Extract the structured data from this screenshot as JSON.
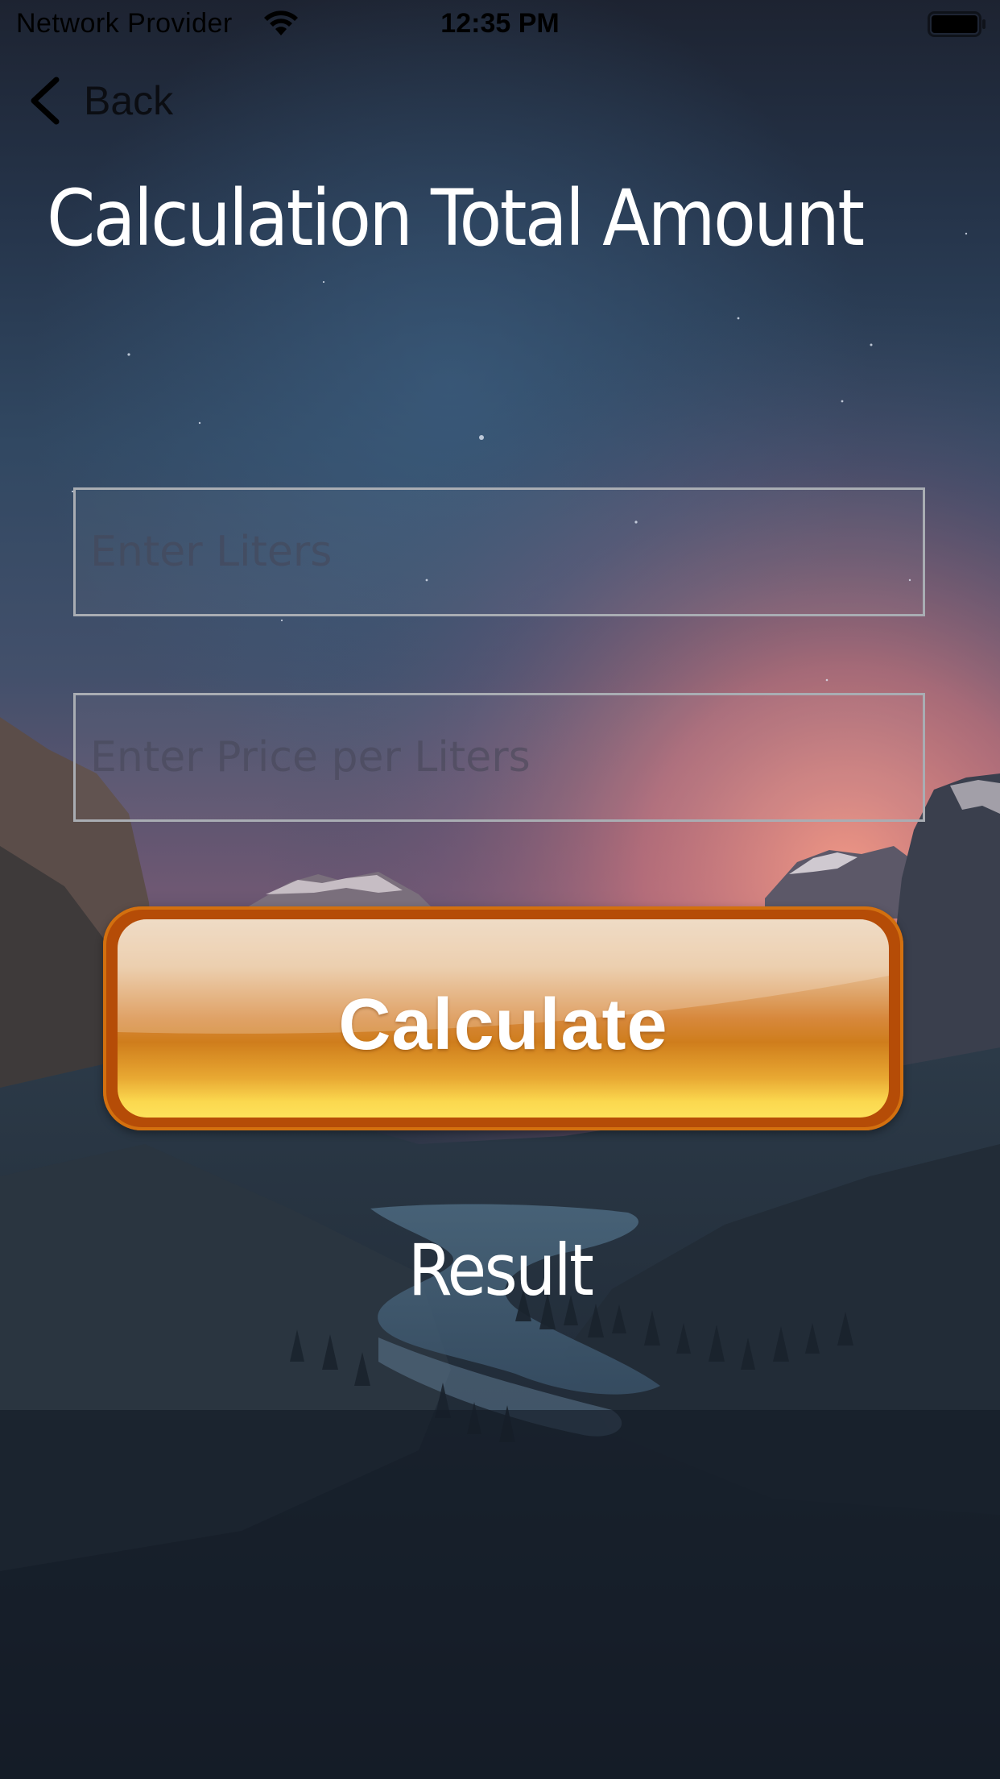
{
  "status_bar": {
    "carrier": "Network Provider",
    "time": "12:35 PM",
    "wifi_icon": "wifi-icon",
    "battery_icon": "battery-full-icon"
  },
  "nav": {
    "back_label": "Back",
    "back_icon": "chevron-left-icon"
  },
  "page": {
    "title": "Calculation Total Amount"
  },
  "form": {
    "liters": {
      "value": "",
      "placeholder": "Enter Liters"
    },
    "price_per_liter": {
      "value": "",
      "placeholder": "Enter Price per Liters"
    },
    "calculate_label": "Calculate"
  },
  "result": {
    "label": "Result"
  },
  "colors": {
    "title_text": "#ffffff",
    "button_border": "#b54c07",
    "button_top": "#ebd2b6",
    "button_bottom": "#fde15a",
    "field_border": "#a9adb3"
  }
}
